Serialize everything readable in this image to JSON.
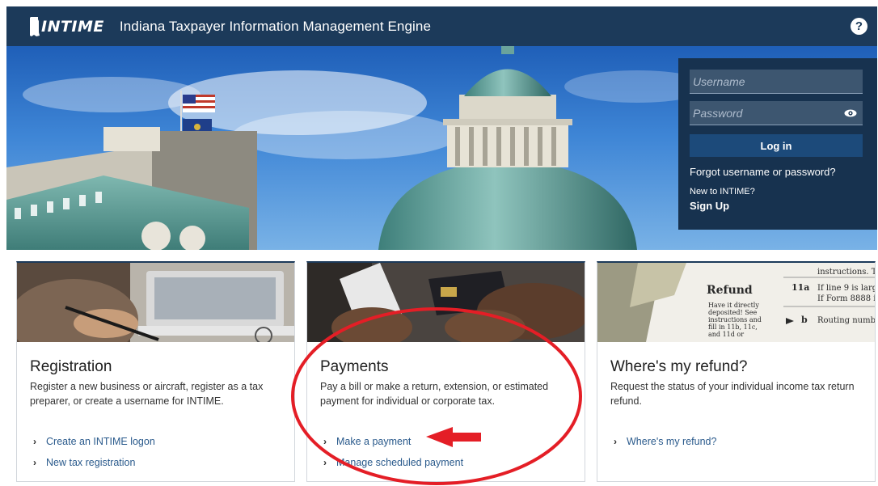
{
  "header": {
    "logo_text": "INTIME",
    "title": "Indiana Taxpayer Information Management Engine",
    "help_label": "?"
  },
  "login": {
    "username_placeholder": "Username",
    "password_placeholder": "Password",
    "login_label": "Log in",
    "forgot_label": "Forgot username or password?",
    "new_to_label": "New to INTIME?",
    "signup_label": "Sign Up"
  },
  "cards": [
    {
      "title": "Registration",
      "description": "Register a new business or aircraft, register as a tax preparer, or create a username for INTIME.",
      "links": [
        "Create an INTIME logon",
        "New tax registration"
      ]
    },
    {
      "title": "Payments",
      "description": "Pay a bill or make a return, extension, or estimated payment for individual or corporate tax.",
      "links": [
        "Make a payment",
        "Manage scheduled payment"
      ]
    },
    {
      "title": "Where's my refund?",
      "description": "Request the status of your individual income tax return refund.",
      "links": [
        "Where's my refund?"
      ]
    }
  ],
  "refund_photo_text": {
    "heading": "Refund",
    "line_11a": "11a",
    "line_11a_text": "If line 9 is larg",
    "form_text": "If Form 8888 i",
    "instructions": "instructions. Tl",
    "side_note": [
      "Have it directly",
      "deposited! See",
      "instructions and",
      "fill in 11b, 11c,",
      "and 11d or"
    ],
    "b_label": "b",
    "routing": "Routing numb"
  },
  "colors": {
    "header_bg": "#1c3a5a",
    "login_bg": "#17324f",
    "link": "#2a5a8c",
    "annotation": "#e41e26"
  },
  "icons": [
    "help-icon",
    "eye-icon",
    "chevron-right-icon",
    "arrow-left-icon"
  ]
}
